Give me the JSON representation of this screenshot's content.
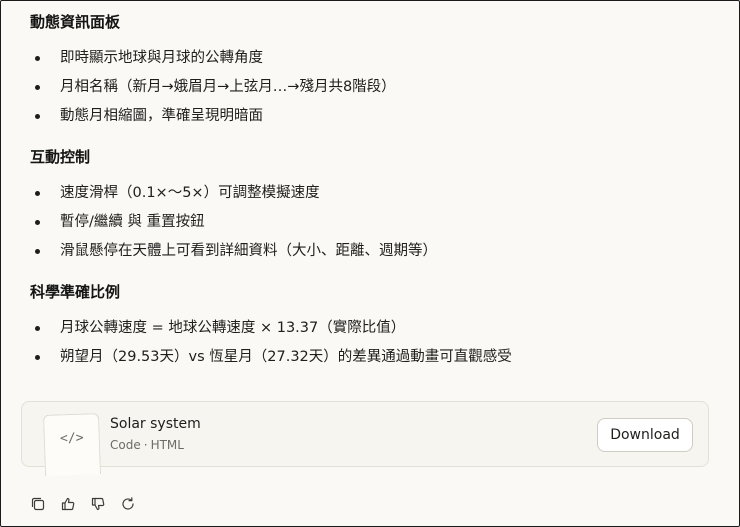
{
  "sections": [
    {
      "title": "動態資訊面板",
      "items": [
        "即時顯示地球與月球的公轉角度",
        "月相名稱（新月→娥眉月→上弦月…→殘月共8階段）",
        "動態月相縮圖，準確呈現明暗面"
      ]
    },
    {
      "title": "互動控制",
      "items": [
        "速度滑桿（0.1×～5×）可調整模擬速度",
        "暫停/繼續 與 重置按鈕",
        "滑鼠懸停在天體上可看到詳細資料（大小、距離、週期等）"
      ]
    },
    {
      "title": "科學準確比例",
      "items": [
        "月球公轉速度 = 地球公轉速度 × 13.37（實際比值）",
        "朔望月（29.53天）vs 恆星月（27.32天）的差異通過動畫可直觀感受"
      ]
    }
  ],
  "artifact": {
    "icon_text": "</>",
    "title": "Solar system",
    "type": "Code",
    "separator": "·",
    "language": "HTML",
    "download_label": "Download"
  },
  "actions": {
    "icons": [
      "copy-icon",
      "thumbs-up-icon",
      "thumbs-down-icon",
      "retry-icon"
    ]
  }
}
